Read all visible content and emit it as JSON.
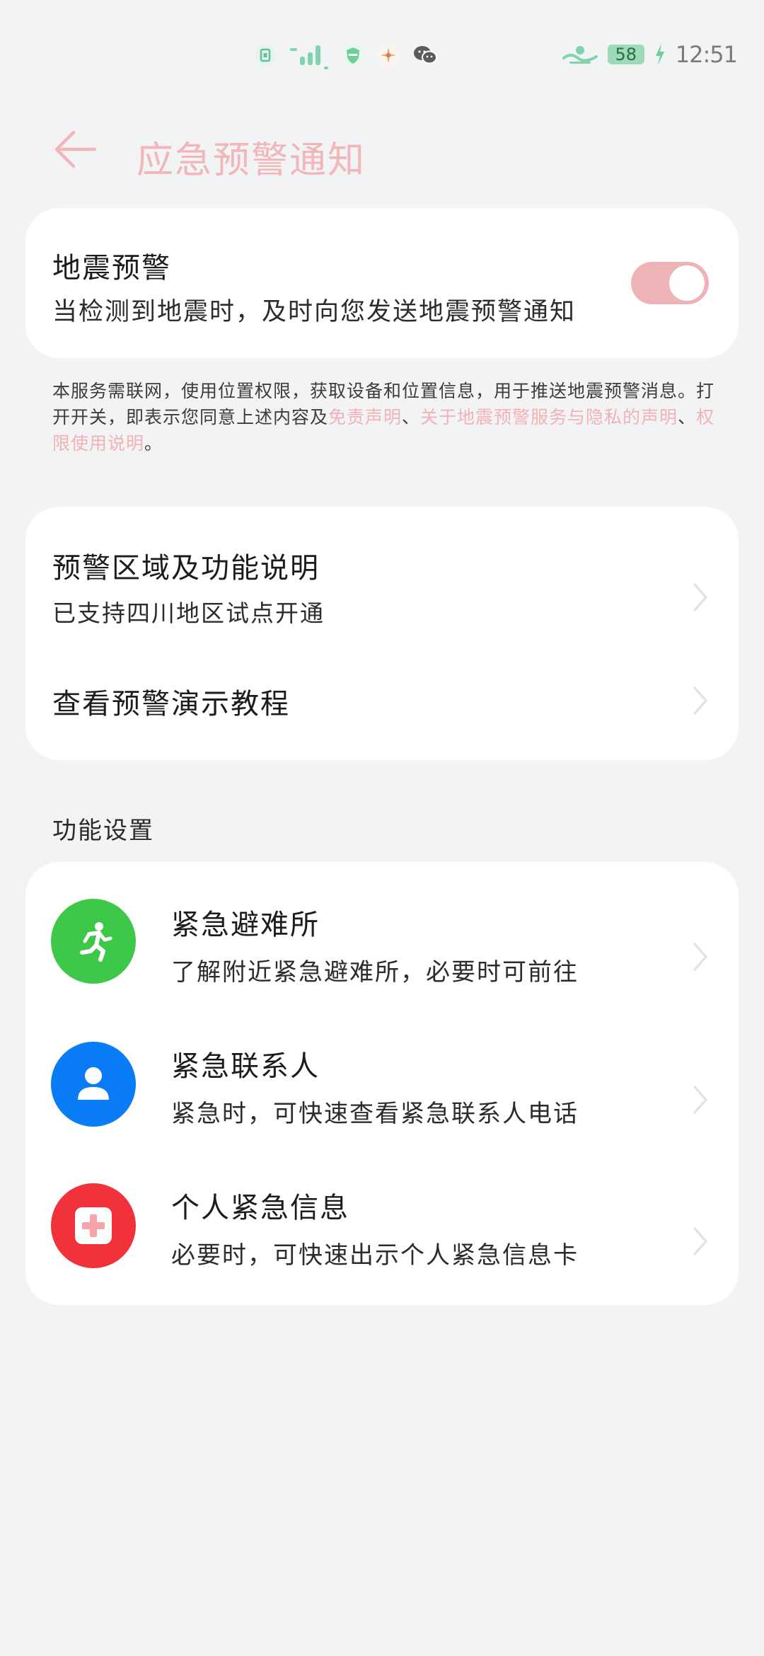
{
  "status_bar": {
    "battery": "58",
    "time": "12:51"
  },
  "header": {
    "title": "应急预警通知"
  },
  "earthquake_card": {
    "title": "地震预警",
    "subtitle": "当检测到地震时，及时向您发送地震预警通知",
    "toggle_on": true
  },
  "disclaimer": {
    "text_before": "本服务需联网，使用位置权限，获取设备和位置信息，用于推送地震预警消息。打开开关，即表示您同意上述内容及",
    "link1": "免责声明",
    "sep1": "、",
    "link2": "关于地震预警服务与隐私的声明",
    "sep2": "、",
    "link3": "权限使用说明",
    "end": "。"
  },
  "info_card": {
    "items": [
      {
        "title": "预警区域及功能说明",
        "subtitle": "已支持四川地区试点开通"
      },
      {
        "title": "查看预警演示教程"
      }
    ]
  },
  "section": {
    "label": "功能设置"
  },
  "features": {
    "items": [
      {
        "icon": "running-person-icon",
        "title": "紧急避难所",
        "subtitle": "了解附近紧急避难所，必要时可前往",
        "color": "#3ec84a"
      },
      {
        "icon": "person-icon",
        "title": "紧急联系人",
        "subtitle": "紧急时，可快速查看紧急联系人电话",
        "color": "#0a7cf5"
      },
      {
        "icon": "medical-cross-icon",
        "title": "个人紧急信息",
        "subtitle": "必要时，可快速出示个人紧急信息卡",
        "color": "#f2323a"
      }
    ]
  },
  "colors": {
    "accent": "#f2b5b9",
    "background": "#f1f3f5"
  }
}
